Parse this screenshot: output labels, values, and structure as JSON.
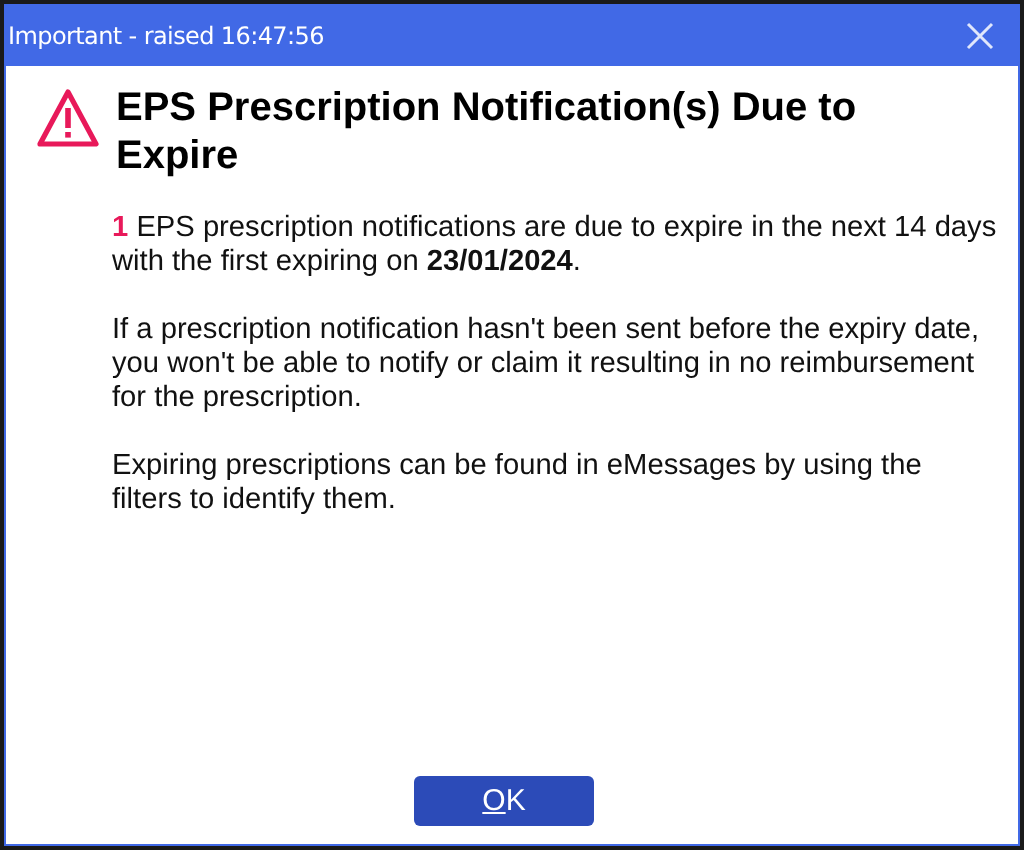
{
  "window": {
    "title": "Important - raised 16:47:56"
  },
  "heading": "EPS Prescription Notification(s) Due to Expire",
  "paragraphs": [
    {
      "count": "1",
      "text": "EPS prescription notifications are due to expire in the next 14 days with the first expiring on **23/01/2024**."
    },
    {
      "text": "If a prescription notification hasn't been sent before the expiry date, you won't be able to notify or claim it resulting in no reimbursement for the prescription."
    },
    {
      "text": "Expiring prescriptions can be found in eMessages by using the filters to identify them."
    }
  ],
  "ok_button": {
    "mnemonic": "O",
    "rest": "K"
  }
}
